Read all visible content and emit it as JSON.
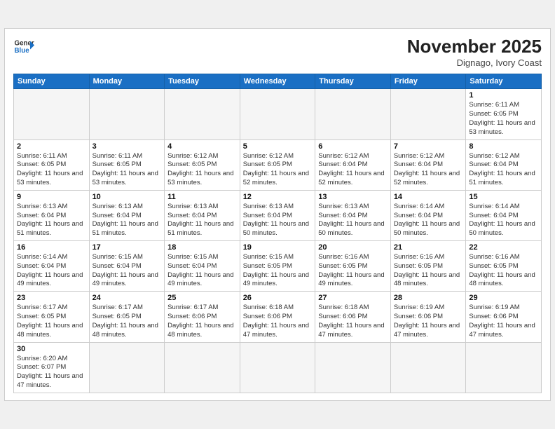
{
  "header": {
    "logo_general": "General",
    "logo_blue": "Blue",
    "month_year": "November 2025",
    "location": "Dignago, Ivory Coast"
  },
  "weekdays": [
    "Sunday",
    "Monday",
    "Tuesday",
    "Wednesday",
    "Thursday",
    "Friday",
    "Saturday"
  ],
  "weeks": [
    [
      {
        "day": "",
        "empty": true
      },
      {
        "day": "",
        "empty": true
      },
      {
        "day": "",
        "empty": true
      },
      {
        "day": "",
        "empty": true
      },
      {
        "day": "",
        "empty": true
      },
      {
        "day": "",
        "empty": true
      },
      {
        "day": "1",
        "sunrise": "6:11 AM",
        "sunset": "6:05 PM",
        "daylight": "11 hours and 53 minutes."
      }
    ],
    [
      {
        "day": "2",
        "sunrise": "6:11 AM",
        "sunset": "6:05 PM",
        "daylight": "11 hours and 53 minutes."
      },
      {
        "day": "3",
        "sunrise": "6:11 AM",
        "sunset": "6:05 PM",
        "daylight": "11 hours and 53 minutes."
      },
      {
        "day": "4",
        "sunrise": "6:12 AM",
        "sunset": "6:05 PM",
        "daylight": "11 hours and 53 minutes."
      },
      {
        "day": "5",
        "sunrise": "6:12 AM",
        "sunset": "6:05 PM",
        "daylight": "11 hours and 52 minutes."
      },
      {
        "day": "6",
        "sunrise": "6:12 AM",
        "sunset": "6:04 PM",
        "daylight": "11 hours and 52 minutes."
      },
      {
        "day": "7",
        "sunrise": "6:12 AM",
        "sunset": "6:04 PM",
        "daylight": "11 hours and 52 minutes."
      },
      {
        "day": "8",
        "sunrise": "6:12 AM",
        "sunset": "6:04 PM",
        "daylight": "11 hours and 51 minutes."
      }
    ],
    [
      {
        "day": "9",
        "sunrise": "6:13 AM",
        "sunset": "6:04 PM",
        "daylight": "11 hours and 51 minutes."
      },
      {
        "day": "10",
        "sunrise": "6:13 AM",
        "sunset": "6:04 PM",
        "daylight": "11 hours and 51 minutes."
      },
      {
        "day": "11",
        "sunrise": "6:13 AM",
        "sunset": "6:04 PM",
        "daylight": "11 hours and 51 minutes."
      },
      {
        "day": "12",
        "sunrise": "6:13 AM",
        "sunset": "6:04 PM",
        "daylight": "11 hours and 50 minutes."
      },
      {
        "day": "13",
        "sunrise": "6:13 AM",
        "sunset": "6:04 PM",
        "daylight": "11 hours and 50 minutes."
      },
      {
        "day": "14",
        "sunrise": "6:14 AM",
        "sunset": "6:04 PM",
        "daylight": "11 hours and 50 minutes."
      },
      {
        "day": "15",
        "sunrise": "6:14 AM",
        "sunset": "6:04 PM",
        "daylight": "11 hours and 50 minutes."
      }
    ],
    [
      {
        "day": "16",
        "sunrise": "6:14 AM",
        "sunset": "6:04 PM",
        "daylight": "11 hours and 49 minutes."
      },
      {
        "day": "17",
        "sunrise": "6:15 AM",
        "sunset": "6:04 PM",
        "daylight": "11 hours and 49 minutes."
      },
      {
        "day": "18",
        "sunrise": "6:15 AM",
        "sunset": "6:04 PM",
        "daylight": "11 hours and 49 minutes."
      },
      {
        "day": "19",
        "sunrise": "6:15 AM",
        "sunset": "6:05 PM",
        "daylight": "11 hours and 49 minutes."
      },
      {
        "day": "20",
        "sunrise": "6:16 AM",
        "sunset": "6:05 PM",
        "daylight": "11 hours and 49 minutes."
      },
      {
        "day": "21",
        "sunrise": "6:16 AM",
        "sunset": "6:05 PM",
        "daylight": "11 hours and 48 minutes."
      },
      {
        "day": "22",
        "sunrise": "6:16 AM",
        "sunset": "6:05 PM",
        "daylight": "11 hours and 48 minutes."
      }
    ],
    [
      {
        "day": "23",
        "sunrise": "6:17 AM",
        "sunset": "6:05 PM",
        "daylight": "11 hours and 48 minutes."
      },
      {
        "day": "24",
        "sunrise": "6:17 AM",
        "sunset": "6:05 PM",
        "daylight": "11 hours and 48 minutes."
      },
      {
        "day": "25",
        "sunrise": "6:17 AM",
        "sunset": "6:06 PM",
        "daylight": "11 hours and 48 minutes."
      },
      {
        "day": "26",
        "sunrise": "6:18 AM",
        "sunset": "6:06 PM",
        "daylight": "11 hours and 47 minutes."
      },
      {
        "day": "27",
        "sunrise": "6:18 AM",
        "sunset": "6:06 PM",
        "daylight": "11 hours and 47 minutes."
      },
      {
        "day": "28",
        "sunrise": "6:19 AM",
        "sunset": "6:06 PM",
        "daylight": "11 hours and 47 minutes."
      },
      {
        "day": "29",
        "sunrise": "6:19 AM",
        "sunset": "6:06 PM",
        "daylight": "11 hours and 47 minutes."
      }
    ],
    [
      {
        "day": "30",
        "sunrise": "6:20 AM",
        "sunset": "6:07 PM",
        "daylight": "11 hours and 47 minutes."
      },
      {
        "day": "",
        "empty": true
      },
      {
        "day": "",
        "empty": true
      },
      {
        "day": "",
        "empty": true
      },
      {
        "day": "",
        "empty": true
      },
      {
        "day": "",
        "empty": true
      },
      {
        "day": "",
        "empty": true
      }
    ]
  ]
}
